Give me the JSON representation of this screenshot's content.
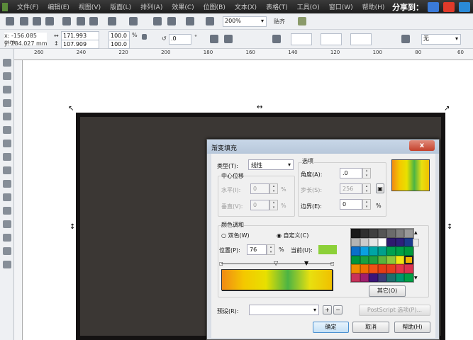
{
  "menu": [
    "文件(F)",
    "编辑(E)",
    "视图(V)",
    "版面(L)",
    "排列(A)",
    "效果(C)",
    "位图(B)",
    "文本(X)",
    "表格(T)",
    "工具(O)",
    "窗口(W)",
    "帮助(H)"
  ],
  "share_label": "分享到：",
  "toolbar": {
    "zoom": "200%",
    "snap": "贴齐"
  },
  "props": {
    "x": "x: -156.085 mm",
    "y": "y: 284.027 mm",
    "w": "171.993 mm",
    "h": "107.909 mm",
    "sx": "100.0",
    "sy": "100.0",
    "pct": "%",
    "angle": ".0",
    "deg": "°",
    "outline": "无"
  },
  "ruler_ticks": [
    "260",
    "240",
    "220",
    "200",
    "180",
    "160",
    "140",
    "120",
    "100",
    "80",
    "60"
  ],
  "dialog": {
    "title": "渐变填充",
    "close": "x",
    "type_label": "类型(T):",
    "type_value": "线性",
    "center_group": "中心位移",
    "h_label": "水平(I):",
    "h_value": "0",
    "v_label": "垂直(V):",
    "v_value": "0",
    "pct": "%",
    "options_group": "选项",
    "angle_label": "角度(A):",
    "angle_value": ".0",
    "steps_label": "步长(S):",
    "steps_value": "256",
    "edge_label": "边界(E):",
    "edge_value": "0",
    "blend_group": "颜色调和",
    "two_color": "双色(W)",
    "custom": "自定义(C)",
    "pos_label": "位置(P):",
    "pos_value": "76",
    "current_label": "当前(U):",
    "current_color": "#8cd038",
    "other_btn": "其它(O)",
    "preset_label": "预设(R):",
    "preset_value": "",
    "postscript_btn": "PostScript 选项(P)...",
    "ok": "确定",
    "cancel": "取消",
    "help": "帮助(H)",
    "gradient_stops": [
      "#f08a14",
      "#f4c800",
      "#e8e000",
      "#4cb444",
      "#e8e010",
      "#f0c000"
    ],
    "palette": [
      "#1a1a1a",
      "#2e2e2e",
      "#404040",
      "#555555",
      "#6b6b6b",
      "#808080",
      "#999999",
      "#b3b3b3",
      "#cccccc",
      "#e6e6e6",
      "#ffffff",
      "#2e1a6e",
      "#2d1f7a",
      "#1b3a8c",
      "#0a6ec8",
      "#0aa0e0",
      "#00a5a5",
      "#00a08c",
      "#00a050",
      "#00a046",
      "#009a3c",
      "#00953c",
      "#1aa040",
      "#20a040",
      "#5ab43c",
      "#8cc83c",
      "#f0e614",
      "#f0b400",
      "#f08c00",
      "#f06e00",
      "#f05014",
      "#e63c14",
      "#e63c1e",
      "#e63746",
      "#dc3250",
      "#c8325a",
      "#a01e6e",
      "#3c1478",
      "#3c3c78",
      "#1e6e6e",
      "#00966e",
      "#00a046"
    ],
    "palette_selected": 27
  },
  "colors": {
    "canvas_rect": "#3b3734",
    "menubar": "#2a2a2a"
  }
}
